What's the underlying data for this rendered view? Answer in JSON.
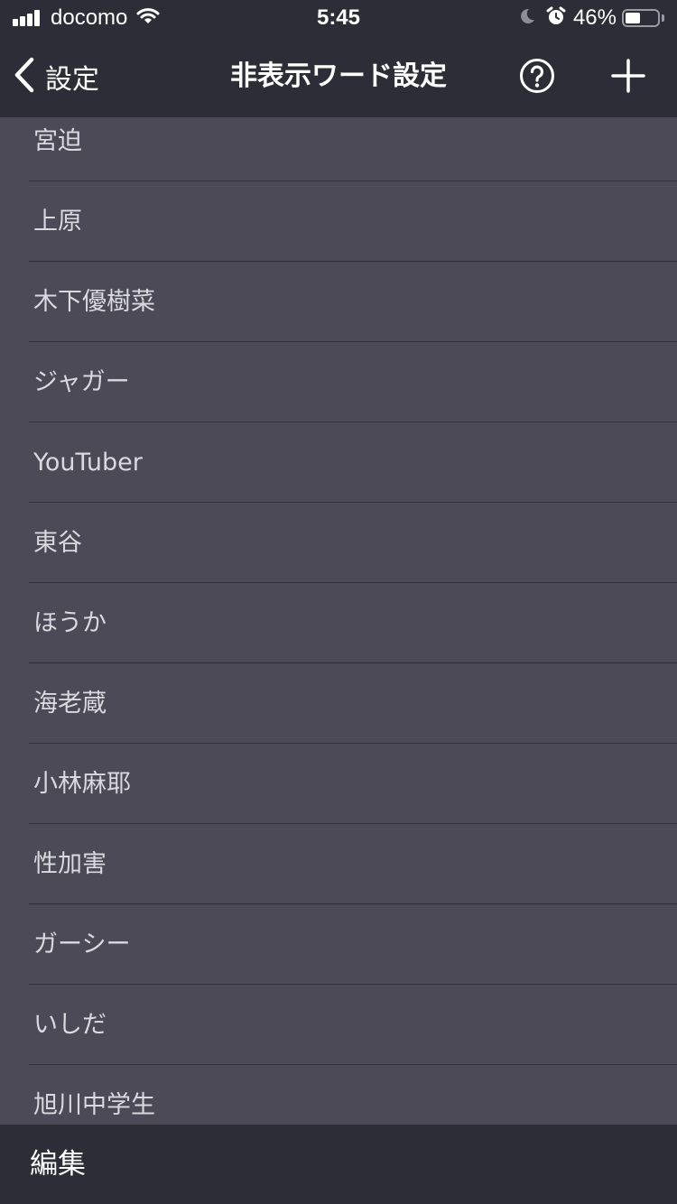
{
  "status_bar": {
    "carrier": "docomo",
    "time": "5:45",
    "battery_percent": "46%",
    "battery_level": 0.46,
    "signal_bars": 4,
    "icons": [
      "cellular-signal-icon",
      "wifi-icon",
      "moon-icon",
      "alarm-icon",
      "battery-icon"
    ]
  },
  "nav": {
    "back_label": "設定",
    "title": "非表示ワード設定",
    "icons": {
      "back": "chevron-left-icon",
      "help": "question-circle-icon",
      "add": "plus-icon"
    }
  },
  "list": {
    "items": [
      {
        "label": "宮迫"
      },
      {
        "label": "上原"
      },
      {
        "label": "木下優樹菜"
      },
      {
        "label": "ジャガー"
      },
      {
        "label": "YouTuber"
      },
      {
        "label": "東谷"
      },
      {
        "label": "ほうか"
      },
      {
        "label": "海老蔵"
      },
      {
        "label": "小林麻耶"
      },
      {
        "label": "性加害"
      },
      {
        "label": "ガーシー"
      },
      {
        "label": "いしだ"
      },
      {
        "label": "旭川中学生"
      }
    ]
  },
  "footer": {
    "edit_label": "編集"
  },
  "colors": {
    "header_bg": "#2d2d37",
    "list_bg": "#4b4a56",
    "item_text": "#d9d9df",
    "separator": "#2f2f38"
  }
}
